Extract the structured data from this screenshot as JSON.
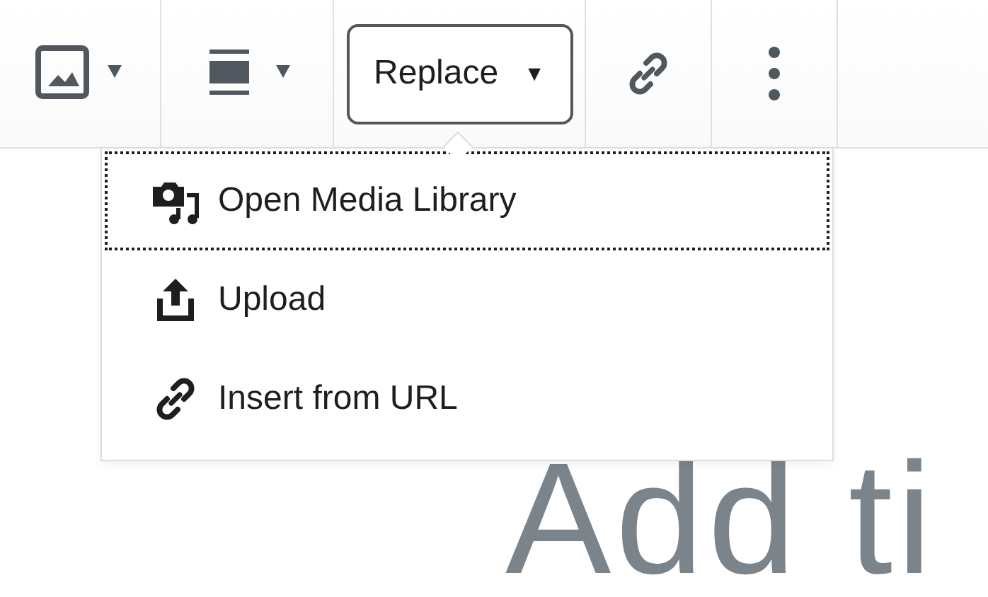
{
  "toolbar": {
    "replace_label": "Replace",
    "replace_caret": "▼"
  },
  "menu": {
    "items": [
      {
        "kind": "media",
        "label": "Open Media Library",
        "focused": true
      },
      {
        "kind": "upload",
        "label": "Upload",
        "focused": false
      },
      {
        "kind": "url",
        "label": "Insert from URL",
        "focused": false
      }
    ]
  },
  "title_placeholder": "Add ti"
}
